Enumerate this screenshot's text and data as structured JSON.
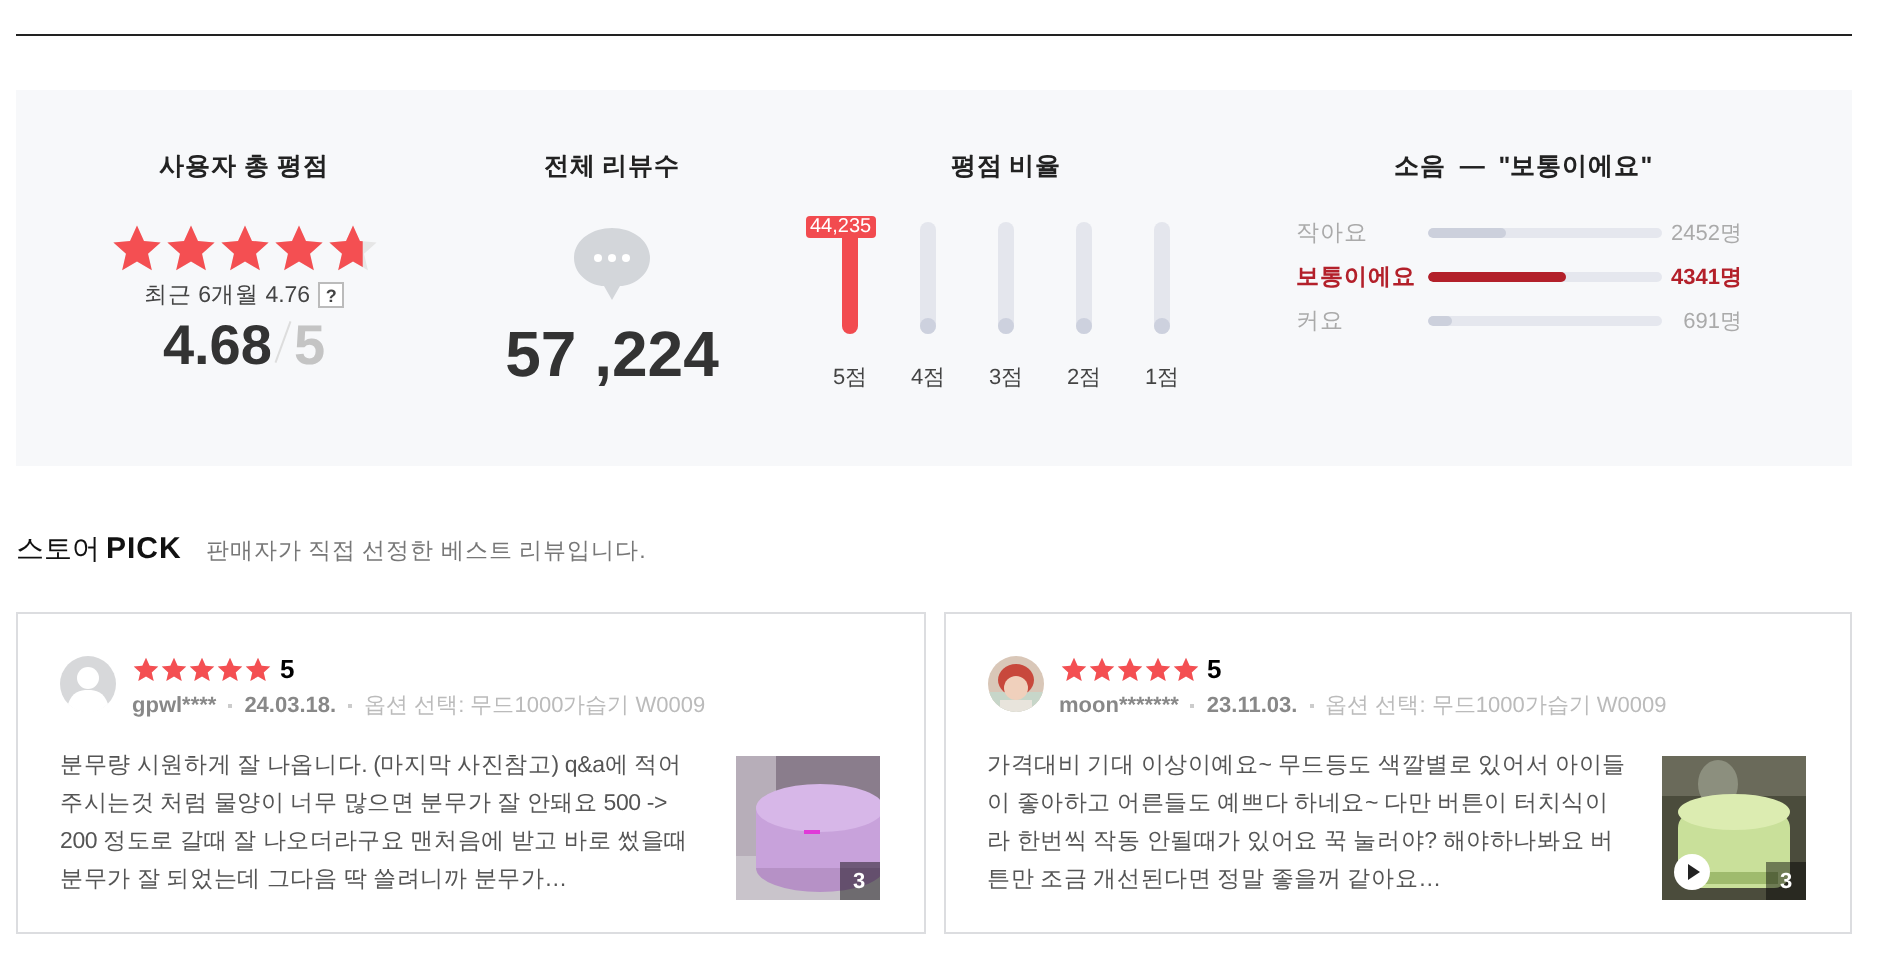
{
  "summary": {
    "total_rating": {
      "title": "사용자 총 평점",
      "stars": 4.68,
      "recent": "최근 6개월 4.76",
      "help": "?",
      "score": "4.68",
      "max": "5"
    },
    "review_count": {
      "title": "전체 리뷰수",
      "count": "57 ,224"
    },
    "distribution": {
      "title": "평점 비율",
      "bars": [
        {
          "label": "5점",
          "level": 0.92,
          "selected": true,
          "count": "44,235"
        },
        {
          "label": "4점",
          "level": 0.06,
          "selected": false
        },
        {
          "label": "3점",
          "level": 0.04,
          "selected": false
        },
        {
          "label": "2점",
          "level": 0.04,
          "selected": false
        },
        {
          "label": "1점",
          "level": 0.04,
          "selected": false
        }
      ]
    },
    "noise": {
      "title": "소음  —  \"보통이에요\"",
      "options": [
        {
          "label": "작아요",
          "level": 0.33,
          "count": "2452명",
          "selected": false
        },
        {
          "label": "보통이에요",
          "level": 0.59,
          "count": "4341명",
          "selected": true
        },
        {
          "label": "커요",
          "level": 0.1,
          "count": "691명",
          "selected": false
        }
      ]
    }
  },
  "store_pick": {
    "title": "스토어",
    "badge": "PICK",
    "description": "판매자가 직접 선정한 베스트 리뷰입니다.",
    "reviews": [
      {
        "avatar": {
          "kind": "default"
        },
        "stars": 5,
        "score": "5",
        "user": "gpwl****",
        "date": "24.03.18.",
        "option": "옵션 선택: 무드1000가습기 W0009",
        "text": "분무량 시원하게 잘 나옵니다. (마지막 사진참고) q&a에 적어주시는것 처럼 물양이 너무 많으면 분무가 잘 안돼요 500 -> 200 정도로 갈때 잘 나오더라구요 맨처음에 받고 바로 썼을때 분무가 잘 되었는데 그다음 딱 쓸려니까 분무가…",
        "photo_count": "3",
        "video": false
      },
      {
        "stars": 5,
        "score": "5",
        "user": "moon*******",
        "date": "23.11.03.",
        "option": "옵션 선택: 무드1000가습기 W0009",
        "text": "가격대비 기대 이상이예요~ 무드등도 색깔별로 있어서 아이들이 좋아하고 어른들도 예쁘다 하네요~ 다만 버튼이 터치식이라 한번씩 작동 안될때가 있어요 꾹 눌러야? 해야하나봐요 버튼만 조금 개선된다면 정말 좋을꺼 같아요…",
        "photo_count": "3",
        "video": true
      }
    ]
  }
}
